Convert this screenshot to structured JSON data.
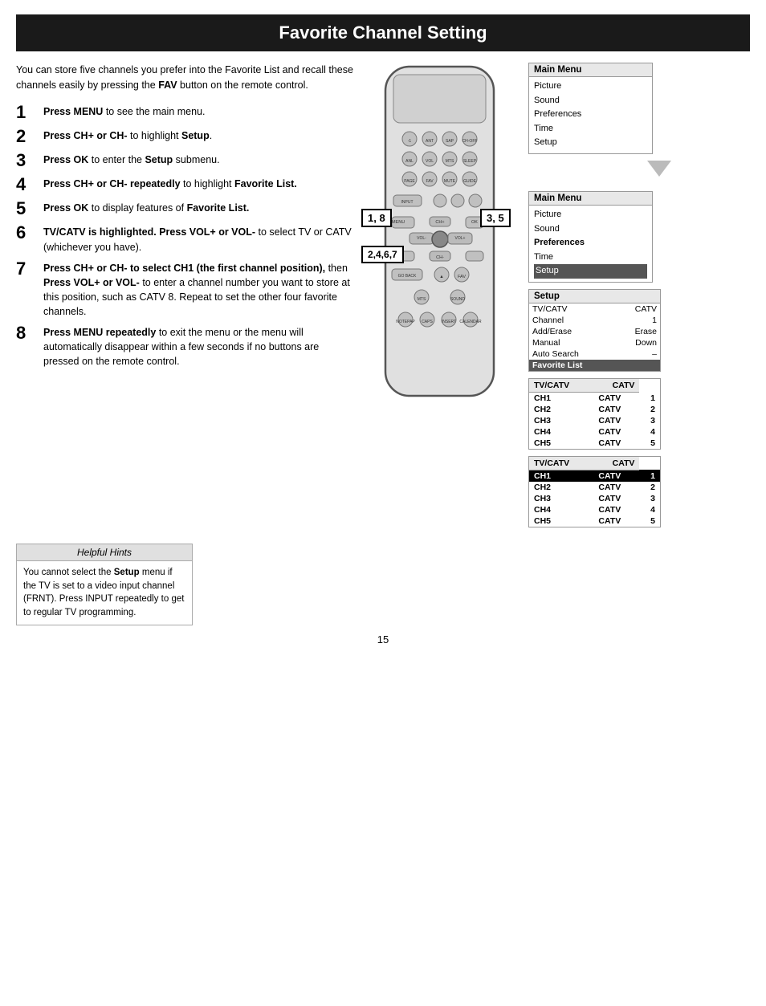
{
  "page": {
    "title": "Favorite Channel Setting",
    "page_number": "15"
  },
  "intro": "You can store five channels you prefer into the Favorite List and recall these channels easily by pressing the FAV button on the remote control.",
  "steps": [
    {
      "num": "1",
      "text": "Press MENU to see the main menu."
    },
    {
      "num": "2",
      "text": "Press CH+ or CH- to highlight Setup."
    },
    {
      "num": "3",
      "text": "Press OK to enter the Setup submenu."
    },
    {
      "num": "4",
      "text": "Press CH+ or CH- repeatedly to highlight Favorite List."
    },
    {
      "num": "5",
      "text": "Press OK to display features of Favorite List."
    },
    {
      "num": "6",
      "text": "TV/CATV is highlighted. Press VOL+ or VOL- to select TV or CATV (whichever you have)."
    },
    {
      "num": "7",
      "text": "Press CH+ or CH- to select CH1 (the first channel position), then Press VOL+ or VOL- to enter a channel number you want to store at this position, such as CATV 8. Repeat to set the other four favorite channels."
    },
    {
      "num": "8",
      "text": "Press MENU repeatedly to exit the menu or the menu will automatically disappear within a few seconds if no buttons are pressed on the remote control."
    }
  ],
  "remote_labels": [
    {
      "id": "label_18",
      "text": "1, 8"
    },
    {
      "id": "label_357",
      "text": "3, 5"
    },
    {
      "id": "label_2467",
      "text": "2,4,6,7"
    }
  ],
  "menus": {
    "main_menu_1": {
      "header": "Main Menu",
      "items": [
        "Picture",
        "Sound",
        "Preferences",
        "Time",
        "Setup"
      ]
    },
    "main_menu_2": {
      "header": "Main Menu",
      "items": [
        "Picture",
        "Sound",
        "Preferences",
        "Time",
        "Setup"
      ],
      "highlighted": "Setup"
    },
    "setup_menu": {
      "header": "Setup",
      "rows": [
        {
          "label": "TV/CATV",
          "value": "CATV"
        },
        {
          "label": "Channel",
          "value": "1"
        },
        {
          "label": "Add/Erase",
          "value": "Erase"
        },
        {
          "label": "Manual",
          "value": "Down"
        },
        {
          "label": "Auto Search",
          "value": "–"
        },
        {
          "label": "Favorite List",
          "value": "",
          "highlighted": true
        }
      ]
    },
    "ch_table_1": {
      "headers": [
        "TV/CATV",
        "CATV"
      ],
      "rows": [
        {
          "ch": "CH1",
          "type": "CATV",
          "num": "1"
        },
        {
          "ch": "CH2",
          "type": "CATV",
          "num": "2"
        },
        {
          "ch": "CH3",
          "type": "CATV",
          "num": "3"
        },
        {
          "ch": "CH4",
          "type": "CATV",
          "num": "4"
        },
        {
          "ch": "CH5",
          "type": "CATV",
          "num": "5"
        }
      ]
    },
    "ch_table_2": {
      "headers": [
        "TV/CATV",
        "CATV"
      ],
      "rows": [
        {
          "ch": "CH1",
          "type": "CATV",
          "num": "1",
          "highlighted": true
        },
        {
          "ch": "CH2",
          "type": "CATV",
          "num": "2"
        },
        {
          "ch": "CH3",
          "type": "CATV",
          "num": "3"
        },
        {
          "ch": "CH4",
          "type": "CATV",
          "num": "4"
        },
        {
          "ch": "CH5",
          "type": "CATV",
          "num": "5"
        }
      ]
    }
  },
  "hints": {
    "header": "Helpful Hints",
    "content": "You cannot select the Setup menu if the TV is set to a video input channel (FRNT). Press INPUT repeatedly to get to regular TV programming."
  }
}
